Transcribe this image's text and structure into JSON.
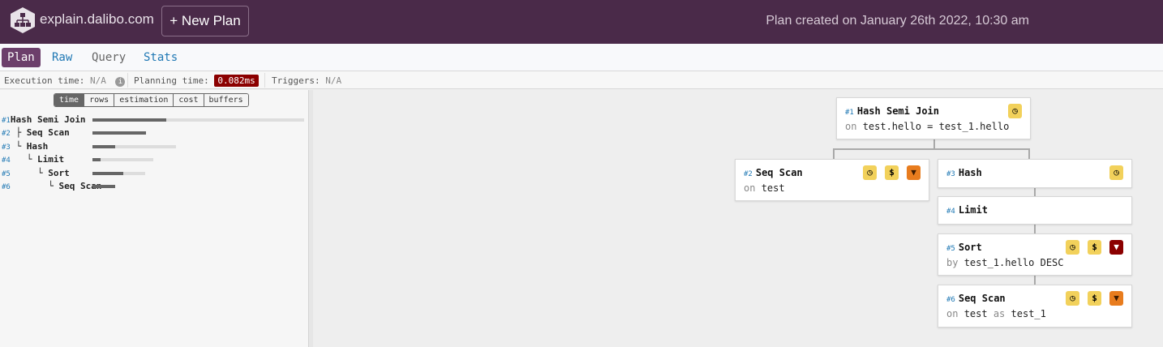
{
  "header": {
    "brand": "explain.dalibo.com",
    "new_plan": "+ New Plan",
    "created": "Plan created on January 26th 2022, 10:30 am"
  },
  "tabs": [
    {
      "label": "Plan"
    },
    {
      "label": "Raw"
    },
    {
      "label": "Query"
    },
    {
      "label": "Stats"
    }
  ],
  "metrics": {
    "execution_label": "Execution time:",
    "execution_value": "N/A",
    "planning_label": "Planning time:",
    "planning_value": "0.082ms",
    "triggers_label": "Triggers:",
    "triggers_value": "N/A"
  },
  "view_modes": [
    "time",
    "rows",
    "estimation",
    "cost",
    "buffers"
  ],
  "tree": [
    {
      "id": "#1",
      "prefix": "",
      "name": "Hash Semi Join",
      "fill": 0.35
    },
    {
      "id": "#2",
      "prefix": "├ ",
      "name": "Seq Scan",
      "fill": 1.0
    },
    {
      "id": "#3",
      "prefix": "└ ",
      "name": "Hash",
      "fill": 0.27
    },
    {
      "id": "#4",
      "prefix": "  └ ",
      "name": "Limit",
      "fill": 0.13
    },
    {
      "id": "#5",
      "prefix": "    └ ",
      "name": "Sort",
      "fill": 0.58
    },
    {
      "id": "#6",
      "prefix": "      └ ",
      "name": "Seq Scan",
      "fill": 1.0
    }
  ],
  "nodes": {
    "n1": {
      "id": "#1",
      "name": "Hash Semi Join",
      "kw": "on",
      "detail": "test.hello = test_1.hello"
    },
    "n2": {
      "id": "#2",
      "name": "Seq Scan",
      "kw": "on",
      "detail": "test"
    },
    "n3": {
      "id": "#3",
      "name": "Hash"
    },
    "n4": {
      "id": "#4",
      "name": "Limit"
    },
    "n5": {
      "id": "#5",
      "name": "Sort",
      "kw": "by",
      "detail": "test_1.hello DESC"
    },
    "n6": {
      "id": "#6",
      "name": "Seq Scan",
      "kw": "on",
      "detail": "test",
      "kw2": "as",
      "detail2": "test_1"
    }
  },
  "colors": {
    "header": "#4a2a49",
    "accent": "#6c3f6b",
    "link": "#1f78b4",
    "warning": "#e87c1e",
    "danger": "#8b0000",
    "time_badge": "#f2d15b"
  },
  "icons": {
    "clock": "clock-icon",
    "cost": "dollar-icon",
    "warn": "thumbs-down-icon"
  }
}
